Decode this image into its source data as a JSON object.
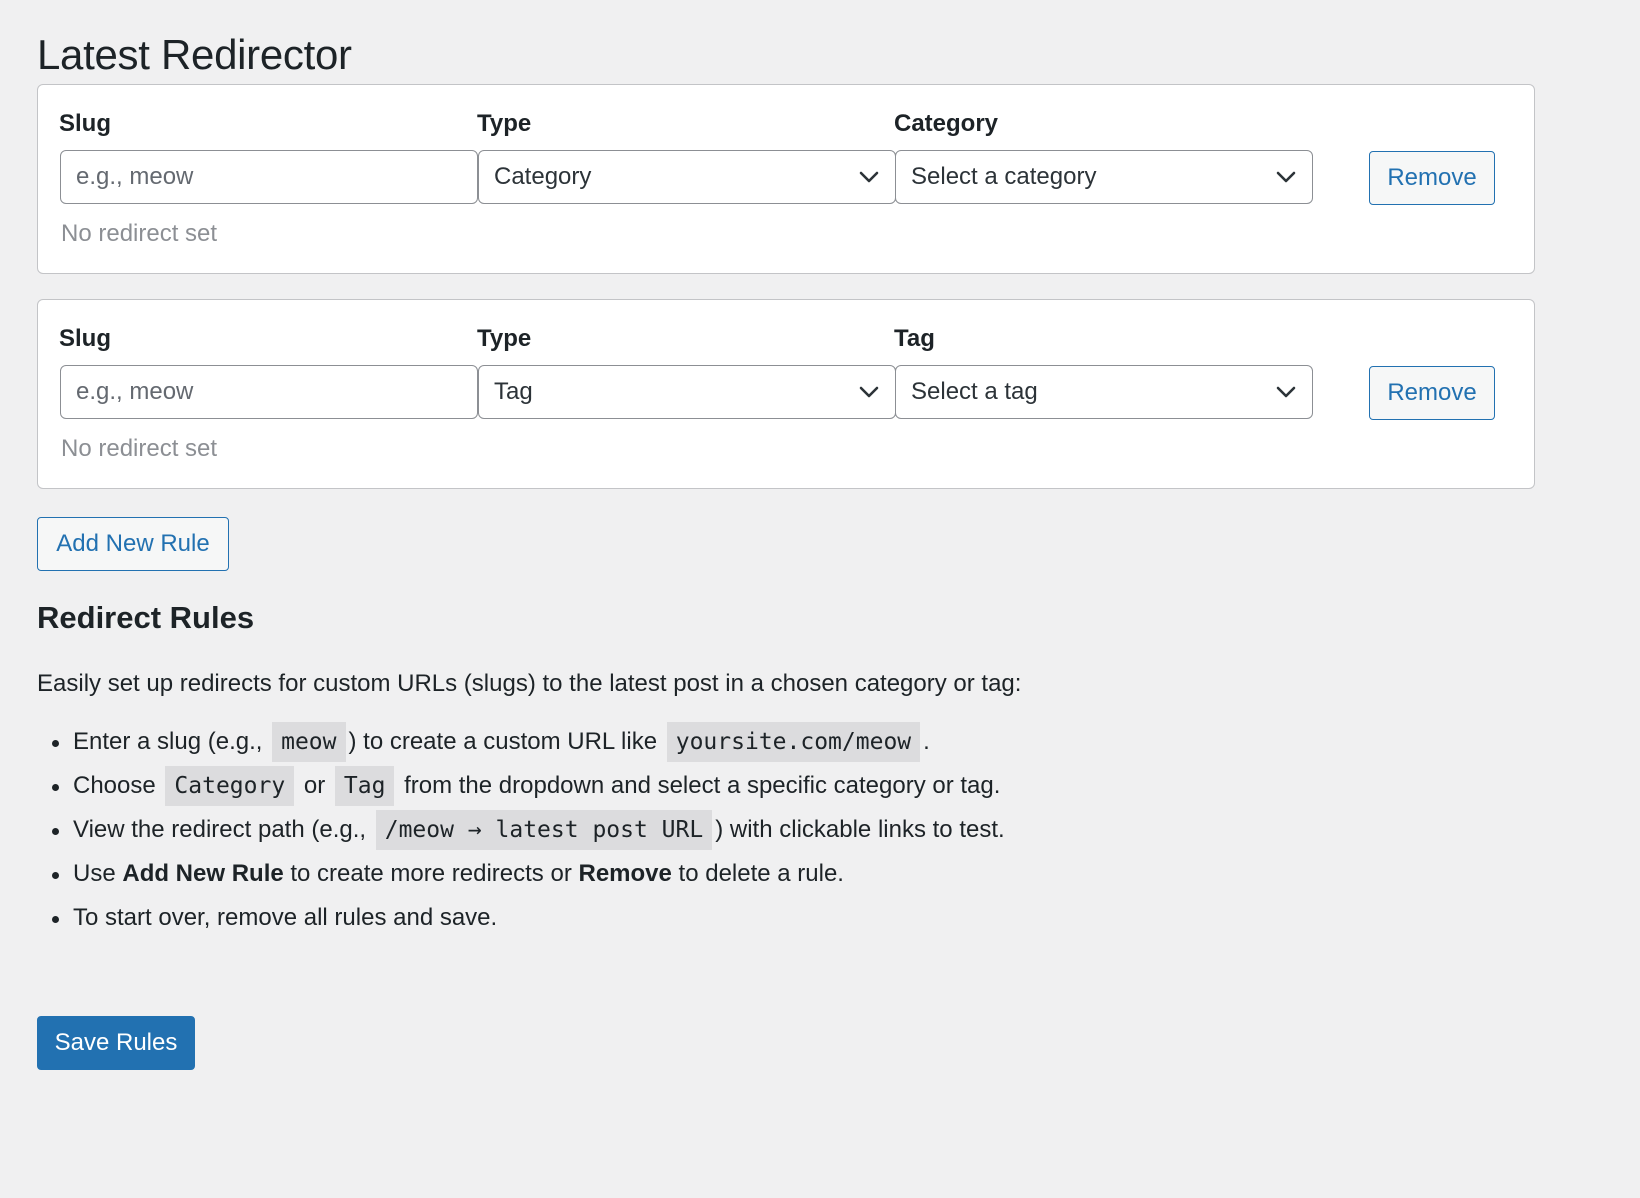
{
  "page": {
    "title": "Latest Redirector"
  },
  "rules": [
    {
      "slug_label": "Slug",
      "slug_placeholder": "e.g., meow",
      "type_label": "Type",
      "type_value": "Category",
      "target_label": "Category",
      "target_value": "Select a category",
      "remove_label": "Remove",
      "status": "No redirect set"
    },
    {
      "slug_label": "Slug",
      "slug_placeholder": "e.g., meow",
      "type_label": "Type",
      "type_value": "Tag",
      "target_label": "Tag",
      "target_value": "Select a tag",
      "remove_label": "Remove",
      "status": "No redirect set"
    }
  ],
  "add_rule_label": "Add New Rule",
  "help": {
    "title": "Redirect Rules",
    "intro": "Easily set up redirects for custom URLs (slugs) to the latest post in a chosen category or tag:",
    "item1": {
      "before": "Enter a slug (e.g.,",
      "code1": "meow",
      "middle": ") to create a custom URL like",
      "code2": "yoursite.com/meow",
      "after": "."
    },
    "item2": {
      "before": "Choose",
      "code1": "Category",
      "middle": "or",
      "code2": "Tag",
      "after": "from the dropdown and select a specific category or tag."
    },
    "item3": {
      "before": "View the redirect path (e.g.,",
      "code1": "/meow → latest post URL",
      "after": ") with clickable links to test."
    },
    "item4": {
      "before": "Use",
      "strong1": "Add New Rule",
      "middle": "to create more redirects or",
      "strong2": "Remove",
      "after": "to delete a rule."
    },
    "item5": {
      "text": "To start over, remove all rules and save."
    }
  },
  "save_label": "Save Rules",
  "colors": {
    "background": "#f0f0f1",
    "accent": "#2271b1",
    "muted": "#8c8f94"
  }
}
